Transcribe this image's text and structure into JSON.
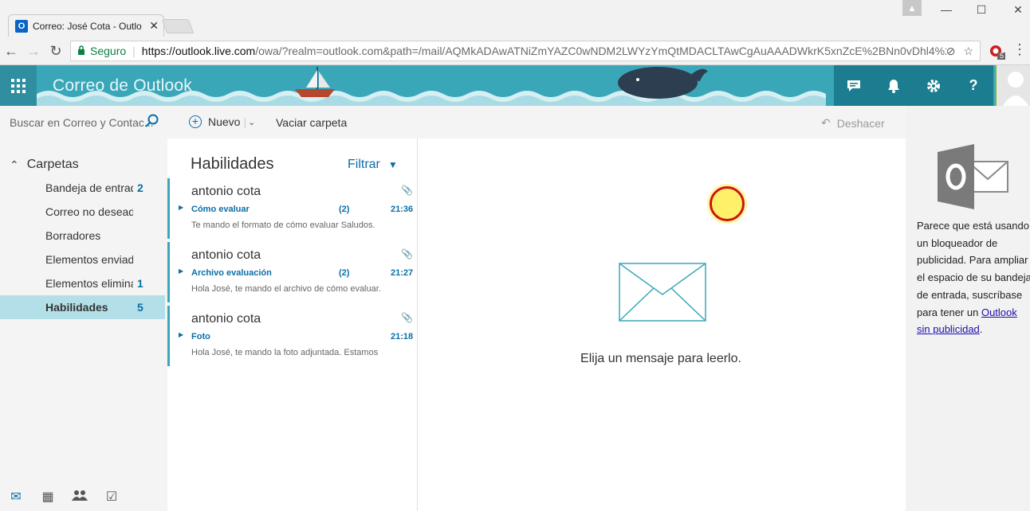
{
  "browser": {
    "tab_title": "Correo: José Cota - Outlo",
    "tab_icon_letter": "O",
    "secure_label": "Seguro",
    "url_host": "https://outlook.live.com",
    "url_rest": "/owa/?realm=outlook.com&path=/mail/AQMkADAwATNiZmYAZC0wNDM2LWYzYmQtMDACLTAwCgAuAAADWkrK5xnZcE%2BNn0vDhl4%2",
    "extension_badge": "5"
  },
  "header": {
    "brand": "Correo de Outlook",
    "buttons": [
      "chat-icon",
      "bell-icon",
      "gear-icon",
      "help-icon"
    ],
    "help_label": "?"
  },
  "toolbar": {
    "search_placeholder": "Buscar en Correo y Contac...",
    "new_label": "Nuevo",
    "empty_label": "Vaciar carpeta",
    "undo_label": "Deshacer"
  },
  "folders": {
    "header": "Carpetas",
    "items": [
      {
        "name": "Bandeja de entrada",
        "count": "2"
      },
      {
        "name": "Correo no deseado",
        "count": ""
      },
      {
        "name": "Borradores",
        "count": ""
      },
      {
        "name": "Elementos enviados",
        "count": ""
      },
      {
        "name": "Elementos eliminados",
        "count": "1"
      },
      {
        "name": "Habilidades",
        "count": "5",
        "selected": true
      }
    ]
  },
  "message_list": {
    "title": "Habilidades",
    "filter_label": "Filtrar",
    "messages": [
      {
        "sender": "antonio cota",
        "subject": "Cómo evaluar",
        "count": "(2)",
        "time": "21:36",
        "preview": "Te mando el formato de cómo evaluar Saludos.",
        "attachment": true
      },
      {
        "sender": "antonio cota",
        "subject": "Archivo evaluación",
        "count": "(2)",
        "time": "21:27",
        "preview": "Hola José, te mando el archivo de cómo evaluar.",
        "attachment": true
      },
      {
        "sender": "antonio cota",
        "subject": "Foto",
        "count": "",
        "time": "21:18",
        "preview": "Hola José, te mando la foto adjuntada. Estamos",
        "attachment": true
      }
    ]
  },
  "reading_pane": {
    "hint": "Elija un mensaje para leerlo."
  },
  "ad_panel": {
    "text_before": "Parece que está usando un bloqueador de publicidad. Para ampliar el espacio de su bandeja de entrada, suscríbase para tener un ",
    "link_text": "Outlook sin publicidad",
    "text_after": "."
  },
  "colors": {
    "accent": "#3aa7b9",
    "header_dark": "#1c7d91",
    "link": "#0a6ea8",
    "selected": "#b3dfe8"
  }
}
